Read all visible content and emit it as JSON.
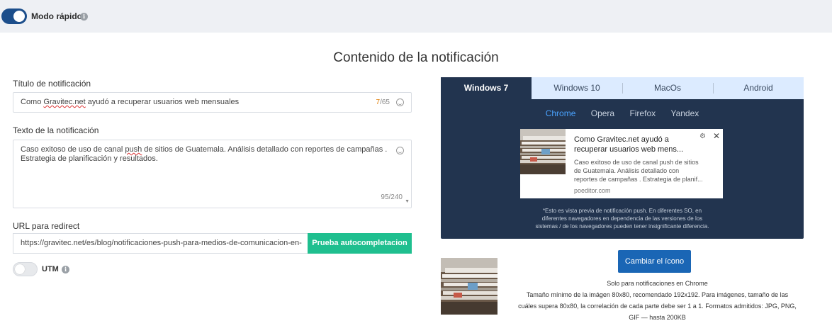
{
  "header": {
    "fast_mode_label": "Modo rápido"
  },
  "section": {
    "title": "Contenido de la notificación"
  },
  "form": {
    "title_label": "Título de notificación",
    "title_value_before": "Como ",
    "title_value_err": "Gravitec.net",
    "title_value_after": " ayudó a recuperar usuarios web mensuales",
    "title_count": "7",
    "title_max": "/65",
    "body_label": "Texto de la notificación",
    "body_value_before": "Caso exitoso de uso de canal ",
    "body_value_err": "push",
    "body_value_after": " de sitios de Guatemala. Análisis detallado con reportes de campañas . Estrategia de planificación y resultados.",
    "body_count": "95/240",
    "url_label": "URL para redirect",
    "url_value": "https://gravitec.net/es/blog/notificaciones-push-para-medios-de-comunicacion-en-",
    "autocomplete_button": "Prueba autocompletacion",
    "utm_label": "UTM",
    "utm_enabled": false,
    "fast_mode_enabled": true
  },
  "preview": {
    "os_tabs": [
      "Windows 7",
      "Windows 10",
      "MacOs",
      "Android"
    ],
    "active_os": "Windows 7",
    "browser_tabs": [
      "Chrome",
      "Opera",
      "Firefox",
      "Yandex"
    ],
    "active_browser": "Chrome",
    "notification": {
      "title_line1": "Como Gravitec.net ayudó a",
      "title_line2": "recuperar usuarios web mens...",
      "body_line1": "Caso exitoso de uso de canal push de sitios",
      "body_line2": "de Guatemala. Análisis detallado con",
      "body_line3": "reportes de campañas . Estrategia de planif...",
      "source": "poeditor.com"
    },
    "note_line1": "*Esto es vista previa de notificación push. En diferentes SO, en",
    "note_line2": "diferentes navegadores en dependencia de las versiones de los",
    "note_line3": "sistemas / de los navegadores pueden tener insignificante diferencia."
  },
  "icon": {
    "change_button": "Cambiar el ícono",
    "info_line1": "Solo para notificaciones en Chrome",
    "info_line2": "Tamaño mínimo de la imágen 80x80, recomendado 192x192. Para imágenes, tamaño de las",
    "info_line3": "cuáles supera 80x80, la correlación  de cada parte debe ser 1 a 1. Formatos admitidos: JPG, PNG,",
    "info_line4": "GIF — hasta 200KB"
  },
  "colors": {
    "toggle_on": "#1c4e8b",
    "preview_bg": "#22344f",
    "autocomplete_button": "#1fbf8f",
    "change_icon_button": "#1a66b5",
    "active_browser": "#4aa3ff"
  }
}
